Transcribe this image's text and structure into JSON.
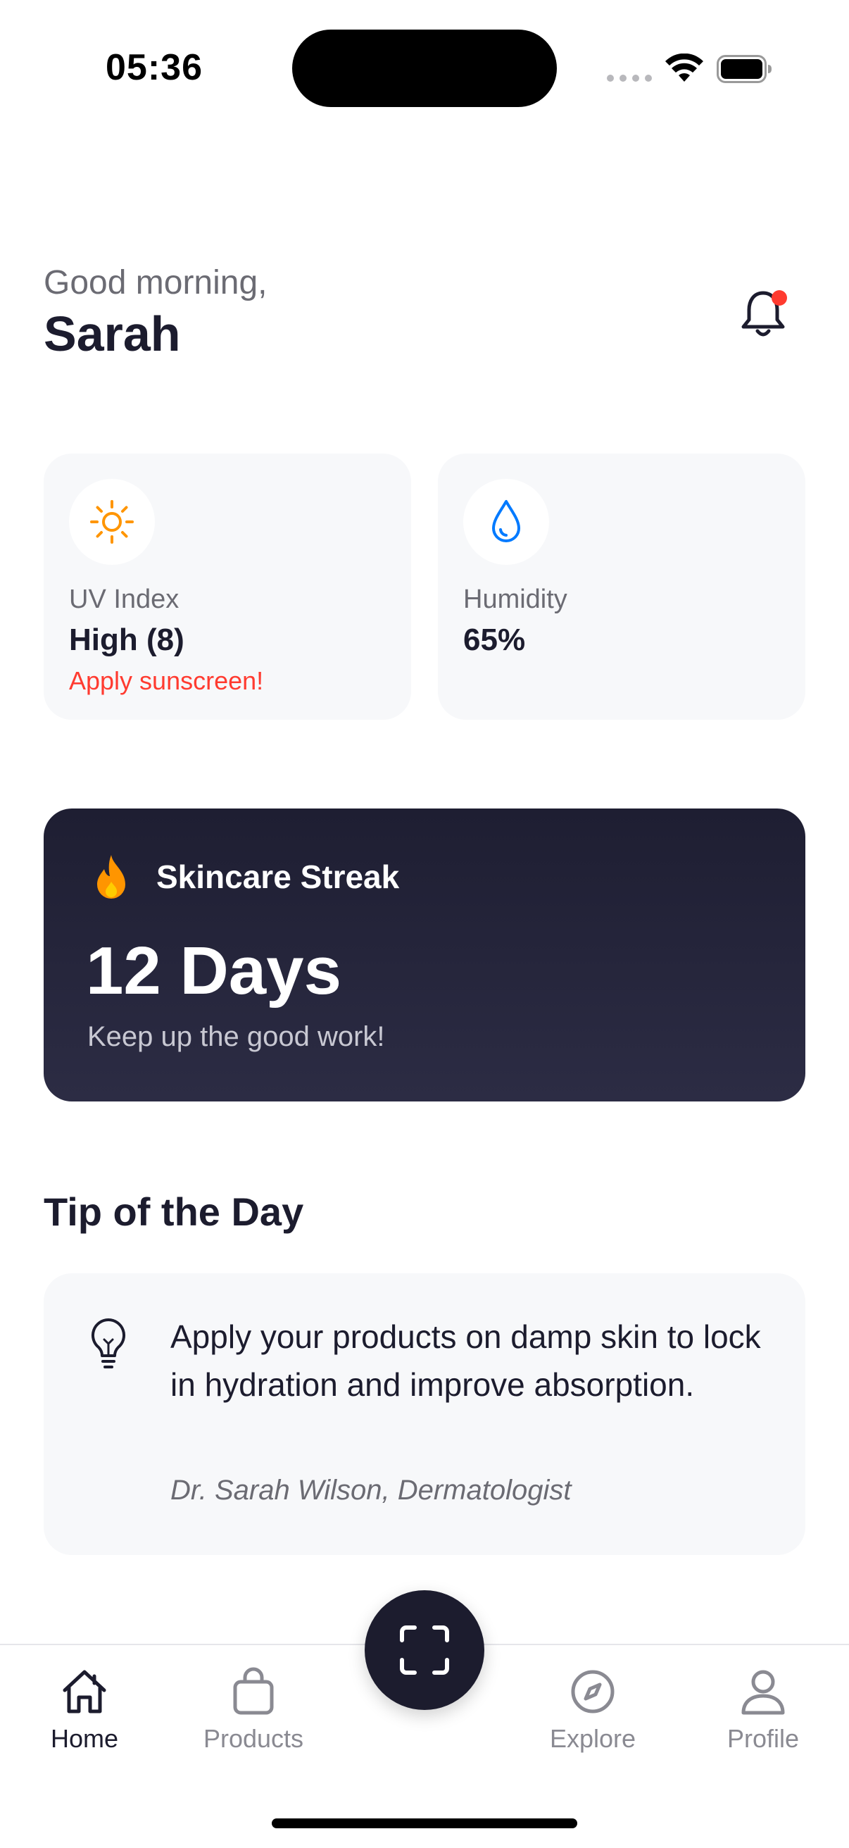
{
  "status_bar": {
    "time": "05:36"
  },
  "header": {
    "greeting": "Good morning,",
    "user_name": "Sarah"
  },
  "weather": {
    "uv": {
      "label": "UV Index",
      "value": "High (8)",
      "note": "Apply sunscreen!",
      "icon": "sun-icon",
      "icon_color": "#ff9500"
    },
    "humidity": {
      "label": "Humidity",
      "value": "65%",
      "icon": "water-drop-icon",
      "icon_color": "#007aff"
    }
  },
  "streak": {
    "title": "Skincare Streak",
    "days": "12 Days",
    "subtitle": "Keep up the good work!",
    "icon": "flame-icon",
    "icon_color": "#ff9500"
  },
  "tip": {
    "heading": "Tip of the Day",
    "text": "Apply your products on damp skin to lock in hydration and improve absorption.",
    "author": "Dr. Sarah Wilson, Dermatologist",
    "icon": "lightbulb-icon"
  },
  "tab_bar": {
    "items": [
      {
        "label": "Home",
        "icon": "home-icon",
        "active": true
      },
      {
        "label": "Products",
        "icon": "shopping-bag-icon",
        "active": false
      },
      {
        "label": "Explore",
        "icon": "compass-icon",
        "active": false
      },
      {
        "label": "Profile",
        "icon": "person-icon",
        "active": false
      }
    ],
    "center_action_icon": "scan-icon"
  },
  "colors": {
    "accent_dark": "#1c1c2e",
    "alert_red": "#ff3b30",
    "muted_text": "#6b6b73",
    "card_background": "#f7f8fa"
  }
}
